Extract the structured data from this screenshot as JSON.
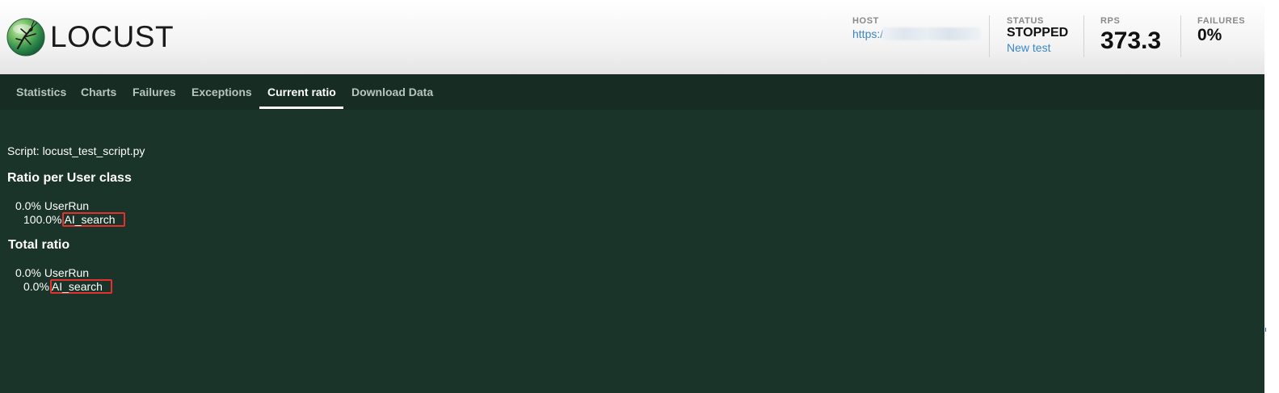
{
  "app": {
    "logo_text": "LOCUST"
  },
  "header": {
    "host": {
      "label": "HOST",
      "value": "https://"
    },
    "status": {
      "label": "STATUS",
      "value": "STOPPED",
      "link": "New test"
    },
    "rps": {
      "label": "RPS",
      "value": "373.3"
    },
    "failures": {
      "label": "FAILURES",
      "value": "0%"
    }
  },
  "tabs": [
    {
      "label": "Statistics",
      "active": false
    },
    {
      "label": "Charts",
      "active": false
    },
    {
      "label": "Failures",
      "active": false
    },
    {
      "label": "Exceptions",
      "active": false
    },
    {
      "label": "Current ratio",
      "active": true
    },
    {
      "label": "Download Data",
      "active": false
    }
  ],
  "content": {
    "script_line": "Script: locust_test_script.py",
    "per_class": {
      "title": "Ratio per User class",
      "rows": [
        {
          "percent": "0.0%",
          "name": "UserRun"
        },
        {
          "percent": "100.0%",
          "name": "AI_search"
        }
      ]
    },
    "total": {
      "title": "Total ratio",
      "rows": [
        {
          "percent": "0.0%",
          "name": "UserRun"
        },
        {
          "percent": "0.0%",
          "name": "AI_search"
        }
      ]
    }
  },
  "colors": {
    "body_bg": "#1a3429",
    "tab_bar_bg": "#172d23",
    "link": "#3a87c4",
    "highlight_box": "#e53030"
  },
  "icons": {
    "logo": "locust-logo-icon"
  }
}
